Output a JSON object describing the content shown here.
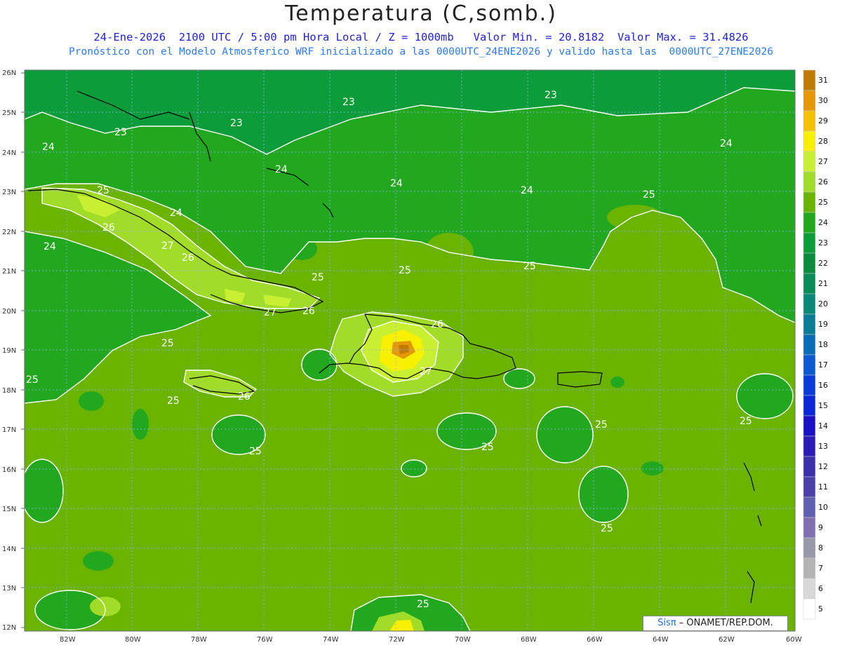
{
  "header": {
    "title": "Temperatura (C,somb.)",
    "line1": "24-Ene-2026  2100 UTC / 5:00 pm Hora Local / Z = 1000mb   Valor Min. = 20.8182  Valor Max. = 31.4826",
    "line2": "Pronóstico con el Modelo Atmosferico WRF inicializado a las 0000UTC_24ENE2026 y valido hasta las  0000UTC_27ENE2026"
  },
  "map": {
    "lat_labels": [
      "26N",
      "25N",
      "24N",
      "23N",
      "22N",
      "21N",
      "20N",
      "19N",
      "18N",
      "17N",
      "16N",
      "15N",
      "14N",
      "13N",
      "12N"
    ],
    "lon_labels": [
      "82W",
      "80W",
      "78W",
      "76W",
      "74W",
      "72W",
      "70W",
      "68W",
      "66W",
      "64W",
      "62W",
      "60W"
    ],
    "contour_labels": [
      "23",
      "23",
      "23",
      "23",
      "24",
      "24",
      "24",
      "24",
      "24",
      "24",
      "24",
      "25",
      "25",
      "25",
      "25",
      "25",
      "25",
      "25",
      "25",
      "25",
      "25",
      "25",
      "25",
      "25",
      "25",
      "26",
      "26",
      "26",
      "26",
      "26",
      "27",
      "27",
      "27"
    ]
  },
  "colorbar": {
    "labels": [
      "31",
      "30",
      "29",
      "28",
      "27",
      "26",
      "25",
      "24",
      "23",
      "22",
      "21",
      "20",
      "19",
      "18",
      "17",
      "16",
      "15",
      "14",
      "13",
      "12",
      "11",
      "10",
      "9",
      "8",
      "7",
      "6",
      "5"
    ],
    "colors": [
      "#c07c00",
      "#e59800",
      "#f5c000",
      "#f7f000",
      "#c8f030",
      "#a0dc28",
      "#6ab400",
      "#22a81e",
      "#0c9c3a",
      "#0a8c3c",
      "#0a8c5a",
      "#0a8878",
      "#0a7c96",
      "#0a6cb4",
      "#0a5ad0",
      "#0a3cdc",
      "#0a28d8",
      "#1a10c8",
      "#2a1cb4",
      "#3a30a8",
      "#4a40a8",
      "#6060b0",
      "#8070b0",
      "#9898a8",
      "#b4b4b4",
      "#d8d8d8",
      "#ffffff"
    ]
  },
  "credit": {
    "sis": "Sisπ",
    "text": " – ONAMET/REP.DOM."
  }
}
